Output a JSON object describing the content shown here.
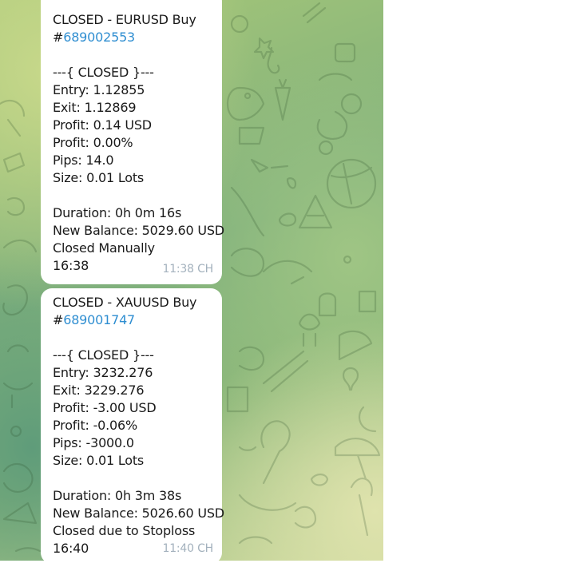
{
  "messages": [
    {
      "header": "CLOSED - EURUSD Buy",
      "hash": "#",
      "ticket": "689002553",
      "status_line": "---{ CLOSED }---",
      "entry": "Entry: 1.12855",
      "exit": "Exit: 1.12869",
      "profit_usd": "Profit: 0.14 USD",
      "profit_pct": "Profit: 0.00%",
      "pips": "Pips: 14.0",
      "size": "Size: 0.01 Lots",
      "duration": "Duration: 0h 0m 16s",
      "balance": "New Balance: 5029.60 USD",
      "closed_reason": "Closed Manually",
      "close_time": "16:38",
      "sent_time": "11:38 CH"
    },
    {
      "header": "CLOSED - XAUUSD Buy",
      "hash": "#",
      "ticket": "689001747",
      "status_line": "---{ CLOSED }---",
      "entry": "Entry: 3232.276",
      "exit": "Exit: 3229.276",
      "profit_usd": "Profit: -3.00 USD",
      "profit_pct": "Profit: -0.06%",
      "pips": "Pips: -3000.0",
      "size": "Size: 0.01 Lots",
      "duration": "Duration: 0h 3m 38s",
      "balance": "New Balance: 5026.60 USD",
      "closed_reason": "Closed due to Stoploss",
      "close_time": "16:40",
      "sent_time": "11:40 CH"
    }
  ],
  "colors": {
    "link": "#2f8ed1",
    "timestamp": "#a3b1bd",
    "bubble": "#ffffff"
  },
  "background_pattern": "chat-doodle-wallpaper"
}
